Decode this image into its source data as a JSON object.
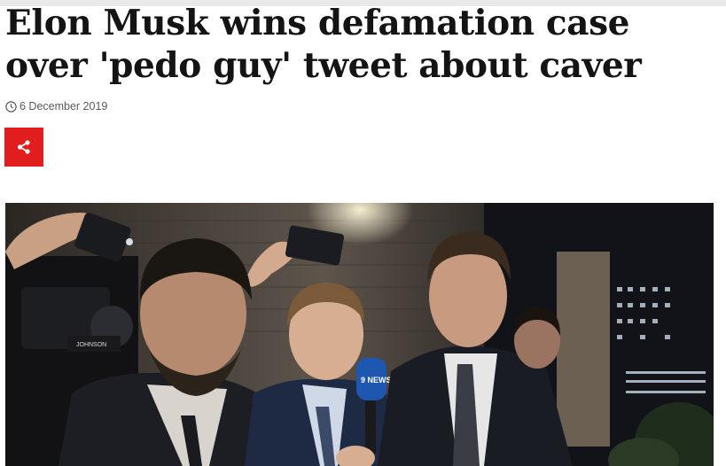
{
  "article": {
    "headline": "Elon Musk wins defamation case over 'pedo guy' tweet about caver",
    "date": "6 December 2019"
  },
  "share": {
    "icon": "share-icon",
    "color": "#e11d1d"
  },
  "photo": {
    "icon": "news-photo",
    "mic_label": "9 NEWS",
    "camera_label": "JOHNSON"
  },
  "colors": {
    "text": "#141414",
    "meta": "#5a5a5a",
    "share_bg": "#e11d1d"
  }
}
